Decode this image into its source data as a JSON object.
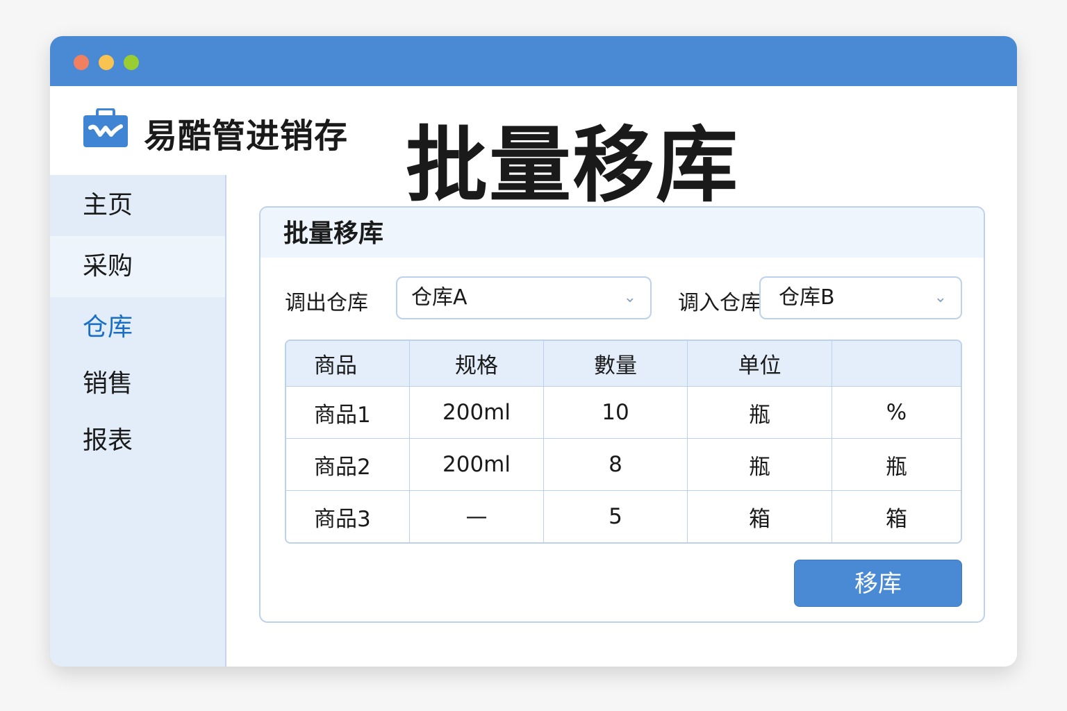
{
  "window": {
    "controls": {
      "close": "#f08060",
      "minimize": "#f8c350",
      "maximize": "#9acd32"
    },
    "titlebar_color": "#4a8ad4"
  },
  "app": {
    "name": "易酷管进销存",
    "logo_icon": "briefcase-icon"
  },
  "page_title": "批量移库",
  "sidebar": {
    "items": [
      {
        "label": "主页"
      },
      {
        "label": "采购"
      },
      {
        "label": "仓库",
        "active": true
      },
      {
        "label": "销售"
      },
      {
        "label": "报表"
      }
    ],
    "active_color": "#1a6fc4"
  },
  "panel": {
    "title": "批量移库",
    "from_label": "调出仓库",
    "from_value": "仓库A",
    "to_label": "调入仓库",
    "to_value": "仓库B",
    "table": {
      "headers": [
        "商品",
        "规格",
        "數量",
        "单位",
        ""
      ],
      "rows": [
        [
          "商品1",
          "200ml",
          "10",
          "瓶",
          "%"
        ],
        [
          "商品2",
          "200ml",
          "8",
          "瓶",
          "瓶"
        ],
        [
          "商品3",
          "—",
          "5",
          "箱",
          "箱"
        ]
      ]
    },
    "submit_label": "移库"
  }
}
